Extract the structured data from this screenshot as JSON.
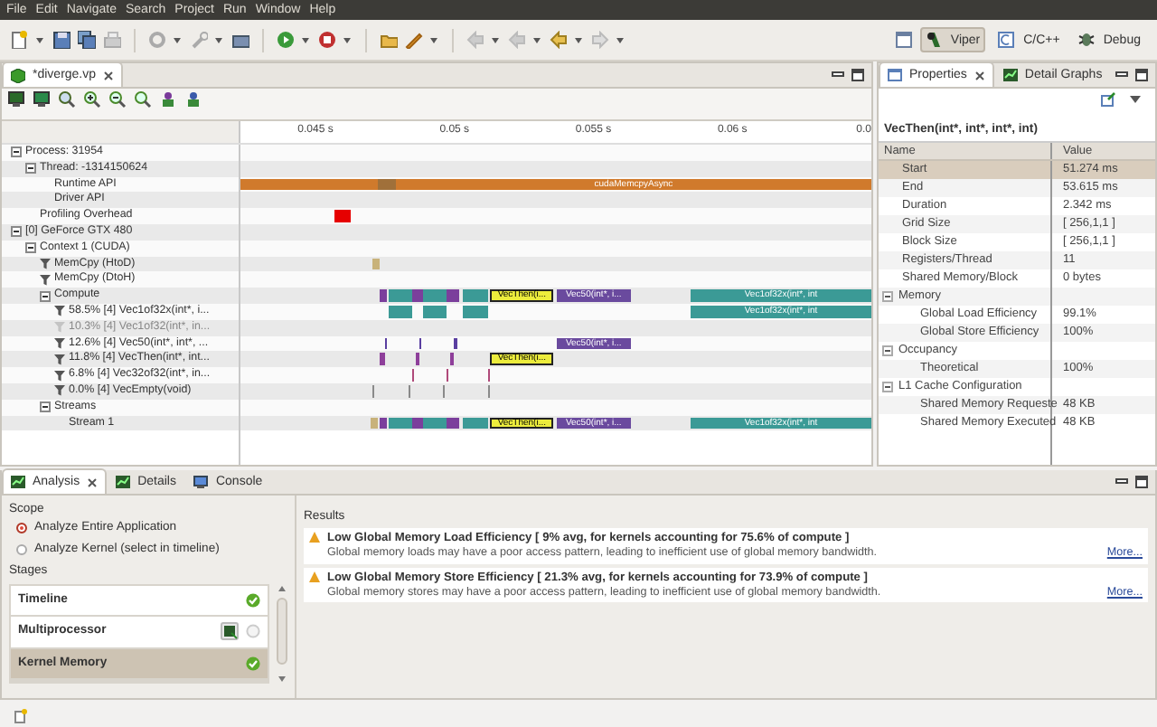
{
  "menu": [
    "File",
    "Edit",
    "Navigate",
    "Search",
    "Project",
    "Run",
    "Window",
    "Help"
  ],
  "perspectives": [
    {
      "label": "Viper",
      "selected": true
    },
    {
      "label": "C/C++",
      "selected": false
    },
    {
      "label": "Debug",
      "selected": false
    }
  ],
  "editor": {
    "tab": {
      "label": "*diverge.vp",
      "selected": true
    },
    "ruler": {
      "ticks": [
        "0.045 s",
        "0.05 s",
        "0.055 s",
        "0.06 s",
        "0.0"
      ]
    },
    "tree": [
      {
        "label": "Process: 31954",
        "kind": "group",
        "expanded": true,
        "children": [
          {
            "label": "Thread: -1314150624",
            "kind": "group",
            "expanded": true,
            "children": [
              {
                "label": "Runtime API",
                "kind": "plain",
                "segments": [
                  {
                    "color": "#d07a2c",
                    "selected": false
                  },
                  {
                    "color": "#a0703a",
                    "selected": false
                  },
                  {
                    "color": "#d07a2c",
                    "selected": false,
                    "label": "cudaMemcpyAsync"
                  }
                ]
              },
              {
                "label": "Driver API",
                "kind": "plain"
              }
            ]
          },
          {
            "label": "Profiling Overhead",
            "kind": "plain",
            "segments": [
              {
                "color": "#e60000",
                "selected": false
              }
            ]
          }
        ]
      },
      {
        "label": "[0] GeForce GTX 480",
        "kind": "group",
        "expanded": true,
        "children": [
          {
            "label": "Context 1 (CUDA)",
            "kind": "group",
            "expanded": true,
            "children": [
              {
                "label": "MemCpy (HtoD)",
                "kind": "filter",
                "disabled": false,
                "segments": [
                  {
                    "color": "#c8b27a",
                    "selected": false
                  }
                ]
              },
              {
                "label": "MemCpy (DtoH)",
                "kind": "filter",
                "disabled": false
              },
              {
                "label": "Compute",
                "kind": "group",
                "expanded": true,
                "segments": [
                  {
                    "color": "#7b3f9c",
                    "selected": false
                  },
                  {
                    "color": "#3b9a96",
                    "selected": false
                  },
                  {
                    "color": "#7b3f9c",
                    "selected": false
                  },
                  {
                    "color": "#3b9a96",
                    "selected": false
                  },
                  {
                    "color": "#7b3f9c",
                    "selected": false
                  },
                  {
                    "color": "#3b9a96",
                    "selected": false
                  },
                  {
                    "color": "#ecec3c",
                    "selected": true,
                    "label": "VecThen(i..."
                  },
                  {
                    "color": "#6a4a9e",
                    "selected": false,
                    "label": "Vec50(int*, i..."
                  },
                  {
                    "color": "#3b9a96",
                    "selected": false,
                    "label": "Vec1of32x(int*, int"
                  }
                ],
                "children": [
                  {
                    "label": "58.5% [4] Vec1of32x(int*, i...",
                    "kind": "filter",
                    "disabled": false,
                    "segments": [
                      {
                        "color": "#3b9a96",
                        "selected": false
                      },
                      {
                        "color": "#3b9a96",
                        "selected": false
                      },
                      {
                        "color": "#3b9a96",
                        "selected": false
                      },
                      {
                        "color": "#3b9a96",
                        "selected": false,
                        "label": "Vec1of32x(int*, int"
                      }
                    ]
                  },
                  {
                    "label": "10.3% [4] Vec1of32(int*, in...",
                    "kind": "filter",
                    "disabled": true
                  },
                  {
                    "label": "12.6% [4] Vec50(int*, int*, ...",
                    "kind": "filter",
                    "disabled": false,
                    "segments": [
                      {
                        "color": "#5a3fa0",
                        "selected": false
                      },
                      {
                        "color": "#5a3fa0",
                        "selected": false
                      },
                      {
                        "color": "#5a3fa0",
                        "selected": false
                      },
                      {
                        "color": "#6a4a9e",
                        "selected": false,
                        "label": "Vec50(int*, i..."
                      }
                    ]
                  },
                  {
                    "label": "11.8% [4] VecThen(int*, int...",
                    "kind": "filter",
                    "disabled": false,
                    "segments": [
                      {
                        "color": "#8e3f9a",
                        "selected": false
                      },
                      {
                        "color": "#8e3f9a",
                        "selected": false
                      },
                      {
                        "color": "#8e3f9a",
                        "selected": false
                      },
                      {
                        "color": "#ecec3c",
                        "selected": true,
                        "label": "VecThen(i..."
                      }
                    ]
                  },
                  {
                    "label": "6.8% [4] Vec32of32(int*, in...",
                    "kind": "filter",
                    "disabled": false,
                    "segments": [
                      {
                        "color": "#b04a7a",
                        "selected": false
                      },
                      {
                        "color": "#b04a7a",
                        "selected": false
                      },
                      {
                        "color": "#b04a7a",
                        "selected": false
                      }
                    ]
                  },
                  {
                    "label": "0.0% [4] VecEmpty(void)",
                    "kind": "filter",
                    "disabled": false,
                    "segments": [
                      {
                        "color": "#8a8a8a",
                        "selected": false
                      },
                      {
                        "color": "#8a8a8a",
                        "selected": false
                      },
                      {
                        "color": "#8a8a8a",
                        "selected": false
                      },
                      {
                        "color": "#8a8a8a",
                        "selected": false
                      }
                    ]
                  }
                ]
              },
              {
                "label": "Streams",
                "kind": "group",
                "expanded": true,
                "children": [
                  {
                    "label": "Stream 1",
                    "kind": "plain",
                    "segments": [
                      {
                        "color": "#c8b27a",
                        "selected": false
                      },
                      {
                        "color": "#7b3f9c",
                        "selected": false
                      },
                      {
                        "color": "#3b9a96",
                        "selected": false
                      },
                      {
                        "color": "#7b3f9c",
                        "selected": false
                      },
                      {
                        "color": "#3b9a96",
                        "selected": false
                      },
                      {
                        "color": "#7b3f9c",
                        "selected": false
                      },
                      {
                        "color": "#3b9a96",
                        "selected": false
                      },
                      {
                        "color": "#ecec3c",
                        "selected": true,
                        "label": "VecThen(i..."
                      },
                      {
                        "color": "#6a4a9e",
                        "selected": false,
                        "label": "Vec50(int*, i..."
                      },
                      {
                        "color": "#3b9a96",
                        "selected": false,
                        "label": "Vec1of32x(int*, int"
                      }
                    ]
                  }
                ]
              }
            ]
          }
        ]
      }
    ]
  },
  "properties": {
    "tabs": [
      {
        "label": "Properties",
        "selected": true
      },
      {
        "label": "Detail Graphs",
        "selected": false
      }
    ],
    "title": "VecThen(int*, int*, int*, int)",
    "columns": [
      "Name",
      "Value"
    ],
    "rows": [
      {
        "name": "Start",
        "value": "51.274 ms",
        "selected": true
      },
      {
        "name": "End",
        "value": "53.615 ms",
        "selected": false
      },
      {
        "name": "Duration",
        "value": "2.342 ms",
        "selected": false
      },
      {
        "name": "Grid Size",
        "value": "[ 256,1,1 ]",
        "selected": false
      },
      {
        "name": "Block Size",
        "value": "[ 256,1,1 ]",
        "selected": false
      },
      {
        "name": "Registers/Thread",
        "value": "11",
        "selected": false
      },
      {
        "name": "Shared  Memory/Block",
        "value": "0 bytes",
        "selected": false
      },
      {
        "name": "Memory",
        "selected": false,
        "expanded": true,
        "children": [
          {
            "name": "Global Load Efficiency",
            "value": "99.1%",
            "selected": false
          },
          {
            "name": "Global Store Efficiency",
            "value": "100%",
            "selected": false
          }
        ]
      },
      {
        "name": "Occupancy",
        "selected": false,
        "expanded": true,
        "children": [
          {
            "name": "Theoretical",
            "value": "100%",
            "selected": false
          }
        ]
      },
      {
        "name": "L1 Cache Configuration",
        "selected": false,
        "expanded": true,
        "children": [
          {
            "name": "Shared Memory Requeste",
            "value": "48 KB",
            "selected": false
          },
          {
            "name": "Shared Memory Executed",
            "value": "48 KB",
            "selected": false
          }
        ]
      }
    ]
  },
  "analysis": {
    "tabs": [
      {
        "label": "Analysis",
        "selected": true
      },
      {
        "label": "Details",
        "selected": false
      },
      {
        "label": "Console",
        "selected": false
      }
    ],
    "scope_label": "Scope",
    "scope_options": [
      {
        "label": "Analyze Entire Application",
        "selected": true
      },
      {
        "label": "Analyze Kernel (select in timeline)",
        "selected": false
      }
    ],
    "stages_label": "Stages",
    "stages": [
      {
        "label": "Timeline",
        "kind": "plain",
        "complete": true,
        "selected": false
      },
      {
        "label": "Multiprocessor",
        "kind": "action",
        "complete": false,
        "selected": false
      },
      {
        "label": "Kernel Memory",
        "kind": "plain",
        "complete": true,
        "selected": true
      }
    ],
    "results_label": "Results",
    "results": [
      {
        "title": "Low Global Memory Load Efficiency [ 9% avg, for kernels accounting for 75.6% of compute ]",
        "description": "Global memory loads may have a poor access pattern, leading to inefficient use of global memory bandwidth.",
        "link": "More..."
      },
      {
        "title": "Low Global Memory Store Efficiency [ 21.3% avg, for kernels accounting for 73.9% of compute ]",
        "description": "Global memory stores may have a poor access pattern, leading to inefficient use of global memory bandwidth.",
        "link": "More..."
      }
    ]
  }
}
